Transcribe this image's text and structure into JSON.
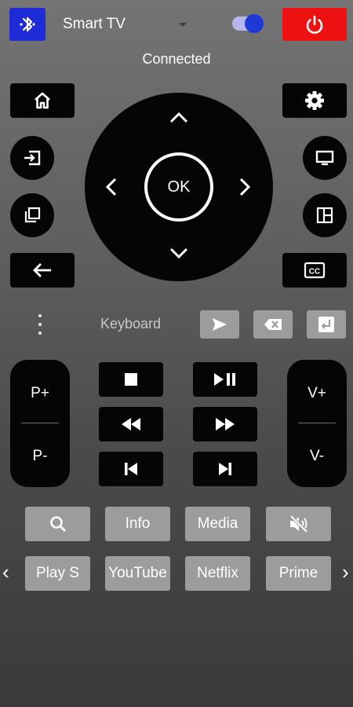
{
  "header": {
    "device_name": "Smart TV",
    "status": "Connected",
    "bluetooth_icon": "bluetooth-icon",
    "toggle_on": true,
    "power_icon": "power-icon",
    "colors": {
      "bluetooth": "#1f2bd6",
      "power": "#ee1111",
      "toggle": "#1f38d8"
    }
  },
  "dpad": {
    "ok_label": "OK"
  },
  "keyboard": {
    "label": "Keyboard"
  },
  "channel": {
    "up": "P+",
    "down": "P-"
  },
  "volume": {
    "up": "V+",
    "down": "V-"
  },
  "quick_buttons": [
    "Info",
    "Media"
  ],
  "apps": [
    "Play S",
    "YouTube",
    "Netflix",
    "Prime"
  ],
  "app_nav": {
    "prev": "‹",
    "next": "›"
  }
}
